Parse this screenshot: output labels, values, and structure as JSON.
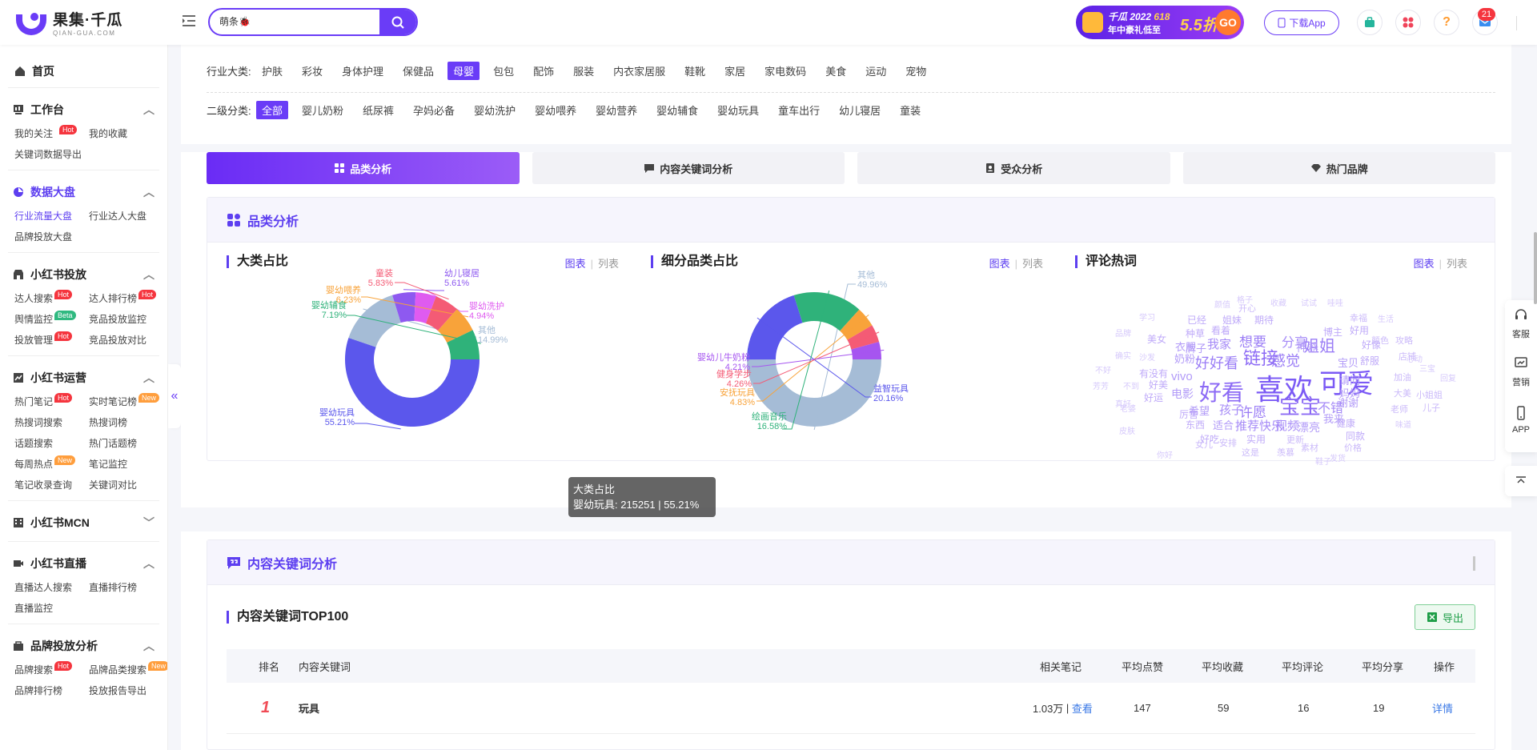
{
  "header": {
    "logo_name": "果集·千瓜",
    "logo_sub": "QIAN-GUA.COM",
    "search_value": "萌条🐞",
    "promo": {
      "title": "千瓜 2022",
      "tag": "618",
      "subtitle": "年中豪礼低至",
      "discount": "5.5折",
      "go": "GO"
    },
    "download_app": "下载App",
    "msg_count": "21"
  },
  "sidebar": {
    "home": "首页",
    "s1": {
      "title": "工作台",
      "items": [
        {
          "label": "我的关注",
          "tag": "Hot"
        },
        {
          "label": "我的收藏"
        },
        {
          "label": "关键词数据导出"
        }
      ]
    },
    "s2": {
      "title": "数据大盘",
      "items": [
        {
          "label": "行业流量大盘"
        },
        {
          "label": "行业达人大盘"
        },
        {
          "label": "品牌投放大盘"
        }
      ]
    },
    "s3": {
      "title": "小红书投放",
      "items": [
        {
          "label": "达人搜索",
          "tag": "Hot"
        },
        {
          "label": "达人排行榜",
          "tag": "Hot"
        },
        {
          "label": "舆情监控",
          "tag": "Beta"
        },
        {
          "label": "竞品投放监控"
        },
        {
          "label": "投放管理",
          "tag": "Hot"
        },
        {
          "label": "竞品投放对比"
        }
      ]
    },
    "s4": {
      "title": "小红书运营",
      "items": [
        {
          "label": "热门笔记",
          "tag": "Hot"
        },
        {
          "label": "实时笔记榜",
          "tag": "New"
        },
        {
          "label": "热搜词搜索"
        },
        {
          "label": "热搜词榜"
        },
        {
          "label": "话题搜索"
        },
        {
          "label": "热门话题榜"
        },
        {
          "label": "每周热点",
          "tag": "New"
        },
        {
          "label": "笔记监控"
        },
        {
          "label": "笔记收录查询"
        },
        {
          "label": "关键词对比"
        }
      ]
    },
    "s5": {
      "title": "小红书MCN"
    },
    "s6": {
      "title": "小红书直播",
      "items": [
        {
          "label": "直播达人搜索"
        },
        {
          "label": "直播排行榜"
        },
        {
          "label": "直播监控"
        }
      ]
    },
    "s7": {
      "title": "品牌投放分析",
      "items": [
        {
          "label": "品牌搜索",
          "tag": "Hot"
        },
        {
          "label": "品牌品类搜索",
          "tag": "New"
        },
        {
          "label": "品牌排行榜"
        },
        {
          "label": "投放报告导出"
        }
      ]
    }
  },
  "filters": {
    "industry_label": "行业大类:",
    "industry": [
      "护肤",
      "彩妆",
      "身体护理",
      "保健品",
      "母婴",
      "包包",
      "配饰",
      "服装",
      "内衣家居服",
      "鞋靴",
      "家居",
      "家电数码",
      "美食",
      "运动",
      "宠物"
    ],
    "industry_selected": "母婴",
    "sub_label": "二级分类:",
    "sub": [
      "全部",
      "婴儿奶粉",
      "纸尿裤",
      "孕妈必备",
      "婴幼洗护",
      "婴幼喂养",
      "婴幼营养",
      "婴幼辅食",
      "婴幼玩具",
      "童车出行",
      "幼儿寝居",
      "童装"
    ],
    "sub_selected": "全部"
  },
  "tabs": [
    "品类分析",
    "内容关键词分析",
    "受众分析",
    "热门品牌"
  ],
  "card1": {
    "title": "品类分析",
    "sw_chart": "图表",
    "sw_list": "列表",
    "p1": {
      "title": "大类占比"
    },
    "p2": {
      "title": "细分品类占比"
    },
    "p3": {
      "title": "评论热词"
    }
  },
  "tooltip": {
    "title": "大类占比",
    "value": "婴幼玩具: 215251 | 55.21%"
  },
  "chart_data": [
    {
      "type": "pie",
      "title": "大类占比",
      "categories": [
        "婴幼玩具",
        "其他",
        "幼儿寝居",
        "婴幼洗护",
        "童装",
        "婴幼喂养",
        "婴幼辅食"
      ],
      "values": [
        55.21,
        14.99,
        5.61,
        4.94,
        5.83,
        6.23,
        7.19
      ],
      "labels": [
        "55.21%",
        "14.99%",
        "5.61%",
        "4.94%",
        "5.83%",
        "6.23%",
        "7.19%"
      ],
      "colors": [
        "#5b57ec",
        "#a5bcd6",
        "#8e59f0",
        "#df5bf0",
        "#f45b75",
        "#f8a33a",
        "#2fb27a"
      ]
    },
    {
      "type": "pie",
      "title": "细分品类占比",
      "categories": [
        "其他",
        "益智玩具",
        "绘画音乐",
        "安抚玩具",
        "健身学步",
        "婴幼儿牛奶粉"
      ],
      "values": [
        49.96,
        20.16,
        16.58,
        4.83,
        4.26,
        4.21
      ],
      "labels": [
        "49.96%",
        "20.16%",
        "16.58%",
        "4.83%",
        "4.26%",
        "4.21%"
      ],
      "colors": [
        "#a5bcd6",
        "#5b57ec",
        "#2fb27a",
        "#f8a33a",
        "#f45b75",
        "#a655f0"
      ]
    }
  ],
  "word_cloud": [
    {
      "t": "喜欢",
      "s": 36,
      "c": "#7b5af5"
    },
    {
      "t": "可爱",
      "s": 34,
      "c": "#7b5af5"
    },
    {
      "t": "好看",
      "s": 28,
      "c": "#8c6af5"
    },
    {
      "t": "宝宝",
      "s": 26,
      "c": "#8c6af5"
    },
    {
      "t": "链接",
      "s": 22,
      "c": "#8c6af5"
    },
    {
      "t": "姐姐",
      "s": 20,
      "c": "#9a7cf6"
    },
    {
      "t": "好好看",
      "s": 18,
      "c": "#9a7cf6"
    },
    {
      "t": "感觉",
      "s": 18,
      "c": "#9a7cf6"
    },
    {
      "t": "想要",
      "s": 17,
      "c": "#9a7cf6"
    },
    {
      "t": "分享",
      "s": 16,
      "c": "#a58af7"
    },
    {
      "t": "许愿",
      "s": 17,
      "c": "#9a7cf6"
    },
    {
      "t": "不错",
      "s": 16,
      "c": "#a58af7"
    },
    {
      "t": "我家",
      "s": 15,
      "c": "#a58af7"
    },
    {
      "t": "孩子",
      "s": 15,
      "c": "#a58af7"
    },
    {
      "t": "视频",
      "s": 15,
      "c": "#a58af7"
    },
    {
      "t": "推荐",
      "s": 15,
      "c": "#a58af7"
    },
    {
      "t": "快乐",
      "s": 15,
      "c": "#a58af7"
    },
    {
      "t": "漂亮",
      "s": 14,
      "c": "#b29bf8"
    },
    {
      "t": "电影",
      "s": 14,
      "c": "#b29bf8"
    },
    {
      "t": "vivo",
      "s": 15,
      "c": "#b29bf8"
    },
    {
      "t": "神器",
      "s": 14,
      "c": "#b29bf8"
    },
    {
      "t": "宝贝",
      "s": 13,
      "c": "#b29bf8"
    },
    {
      "t": "请问",
      "s": 13,
      "c": "#b29bf8"
    },
    {
      "t": "妈妈",
      "s": 13,
      "c": "#b29bf8"
    },
    {
      "t": "谢谢",
      "s": 13,
      "c": "#b29bf8"
    },
    {
      "t": "我来",
      "s": 13,
      "c": "#b29bf8"
    },
    {
      "t": "适合",
      "s": 13,
      "c": "#b29bf8"
    },
    {
      "t": "希望",
      "s": 13,
      "c": "#b29bf8"
    },
    {
      "t": "奶粉",
      "s": 13,
      "c": "#b29bf8"
    },
    {
      "t": "牌子",
      "s": 13,
      "c": "#b29bf8"
    },
    {
      "t": "衣服",
      "s": 13,
      "c": "#b29bf8"
    },
    {
      "t": "看着",
      "s": 12,
      "c": "#bfaaf9"
    },
    {
      "t": "博主",
      "s": 12,
      "c": "#bfaaf9"
    },
    {
      "t": "好用",
      "s": 12,
      "c": "#bfaaf9"
    },
    {
      "t": "好像",
      "s": 12,
      "c": "#bfaaf9"
    },
    {
      "t": "舒服",
      "s": 12,
      "c": "#bfaaf9"
    },
    {
      "t": "种草",
      "s": 12,
      "c": "#bfaaf9"
    },
    {
      "t": "姐妹",
      "s": 12,
      "c": "#bfaaf9"
    },
    {
      "t": "期待",
      "s": 12,
      "c": "#bfaaf9"
    },
    {
      "t": "已经",
      "s": 12,
      "c": "#bfaaf9"
    },
    {
      "t": "美女",
      "s": 12,
      "c": "#bfaaf9"
    },
    {
      "t": "有没有",
      "s": 12,
      "c": "#bfaaf9"
    },
    {
      "t": "好美",
      "s": 12,
      "c": "#bfaaf9"
    },
    {
      "t": "好运",
      "s": 12,
      "c": "#bfaaf9"
    },
    {
      "t": "厉害",
      "s": 12,
      "c": "#bfaaf9"
    },
    {
      "t": "东西",
      "s": 12,
      "c": "#bfaaf9"
    },
    {
      "t": "实用",
      "s": 12,
      "c": "#bfaaf9"
    },
    {
      "t": "好吃",
      "s": 12,
      "c": "#bfaaf9"
    },
    {
      "t": "健康",
      "s": 12,
      "c": "#bfaaf9"
    },
    {
      "t": "同款",
      "s": 12,
      "c": "#bfaaf9"
    },
    {
      "t": "价格",
      "s": 11,
      "c": "#cbbafa"
    },
    {
      "t": "素材",
      "s": 11,
      "c": "#cbbafa"
    },
    {
      "t": "更新",
      "s": 11,
      "c": "#cbbafa"
    },
    {
      "t": "安排",
      "s": 11,
      "c": "#cbbafa"
    },
    {
      "t": "女儿",
      "s": 11,
      "c": "#cbbafa"
    },
    {
      "t": "这是",
      "s": 11,
      "c": "#cbbafa"
    },
    {
      "t": "羡慕",
      "s": 11,
      "c": "#cbbafa"
    },
    {
      "t": "鞋子",
      "s": 10,
      "c": "#d6c9fb"
    },
    {
      "t": "发货",
      "s": 10,
      "c": "#d6c9fb"
    },
    {
      "t": "颜值",
      "s": 10,
      "c": "#d6c9fb"
    },
    {
      "t": "格子",
      "s": 10,
      "c": "#d6c9fb"
    },
    {
      "t": "收藏",
      "s": 10,
      "c": "#d6c9fb"
    },
    {
      "t": "试试",
      "s": 10,
      "c": "#d6c9fb"
    },
    {
      "t": "哇哇",
      "s": 10,
      "c": "#d6c9fb"
    },
    {
      "t": "学习",
      "s": 10,
      "c": "#d6c9fb"
    },
    {
      "t": "开心",
      "s": 11,
      "c": "#cbbafa"
    },
    {
      "t": "幸福",
      "s": 11,
      "c": "#cbbafa"
    },
    {
      "t": "生活",
      "s": 10,
      "c": "#d6c9fb"
    },
    {
      "t": "颜色",
      "s": 11,
      "c": "#cbbafa"
    },
    {
      "t": "攻略",
      "s": 11,
      "c": "#cbbafa"
    },
    {
      "t": "心动",
      "s": 10,
      "c": "#d6c9fb"
    },
    {
      "t": "店铺",
      "s": 11,
      "c": "#cbbafa"
    },
    {
      "t": "三宝",
      "s": 10,
      "c": "#d6c9fb"
    },
    {
      "t": "加油",
      "s": 11,
      "c": "#cbbafa"
    },
    {
      "t": "回复",
      "s": 10,
      "c": "#d6c9fb"
    },
    {
      "t": "大美",
      "s": 11,
      "c": "#cbbafa"
    },
    {
      "t": "小姐姐",
      "s": 11,
      "c": "#cbbafa"
    },
    {
      "t": "老师",
      "s": 11,
      "c": "#cbbafa"
    },
    {
      "t": "儿子",
      "s": 11,
      "c": "#cbbafa"
    },
    {
      "t": "味道",
      "s": 10,
      "c": "#d6c9fb"
    },
    {
      "t": "品牌",
      "s": 10,
      "c": "#d6c9fb"
    },
    {
      "t": "确实",
      "s": 10,
      "c": "#d6c9fb"
    },
    {
      "t": "沙发",
      "s": 10,
      "c": "#d6c9fb"
    },
    {
      "t": "不好",
      "s": 10,
      "c": "#d6c9fb"
    },
    {
      "t": "芳芳",
      "s": 10,
      "c": "#d6c9fb"
    },
    {
      "t": "不到",
      "s": 10,
      "c": "#d6c9fb"
    },
    {
      "t": "真好",
      "s": 10,
      "c": "#d6c9fb"
    },
    {
      "t": "皮肤",
      "s": 10,
      "c": "#d6c9fb"
    },
    {
      "t": "老婆",
      "s": 10,
      "c": "#d6c9fb"
    },
    {
      "t": "你好",
      "s": 10,
      "c": "#d6c9fb"
    }
  ],
  "card2": {
    "title": "内容关键词分析",
    "table_title": "内容关键词TOP100",
    "export": "导出"
  },
  "table": {
    "headers": [
      "排名",
      "内容关键词",
      "相关笔记",
      "平均点赞",
      "平均收藏",
      "平均评论",
      "平均分享",
      "操作"
    ],
    "rows": [
      {
        "rank": "1",
        "keyword": "玩具",
        "notes": "1.03万",
        "view": "查看",
        "likes": "147",
        "collects": "59",
        "comments": "16",
        "shares": "19",
        "detail": "详情"
      }
    ]
  },
  "rail": [
    "客服",
    "营销",
    "APP"
  ]
}
